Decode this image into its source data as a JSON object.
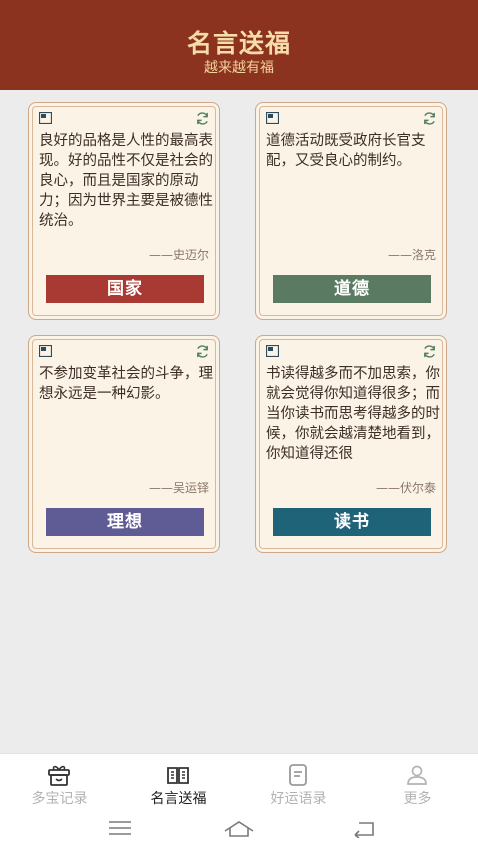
{
  "header": {
    "title": "名言送福",
    "subtitle": "越来越有福"
  },
  "cards": [
    {
      "quote": "良好的品格是人性的最高表现。好的品性不仅是社会的良心，而且是国家的原动力；因为世界主要是被德性统治。",
      "author": "——史迈尔",
      "tag": "国家",
      "tag_color": "#a83a33"
    },
    {
      "quote": "道德活动既受政府长官支配，又受良心的制约。",
      "author": "——洛克",
      "tag": "道德",
      "tag_color": "#5a7a61"
    },
    {
      "quote": "不参加变革社会的斗争，理想永远是一种幻影。",
      "author": "——吴运铎",
      "tag": "理想",
      "tag_color": "#5f5b94"
    },
    {
      "quote": "书读得越多而不加思索，你就会觉得你知道得很多；而当你读书而思考得越多的时候，你就会越清楚地看到，你知道得还很",
      "author": "——伏尔泰",
      "tag": "读书",
      "tag_color": "#1e6378"
    }
  ],
  "tabs": [
    {
      "label": "多宝记录",
      "icon": "gift-box-icon"
    },
    {
      "label": "名言送福",
      "icon": "open-book-icon"
    },
    {
      "label": "好运语录",
      "icon": "document-icon"
    },
    {
      "label": "更多",
      "icon": "person-icon"
    }
  ],
  "active_tab": "名言送福",
  "colors": {
    "header_bg": "#8c3320",
    "header_text": "#f5dca8",
    "card_bg": "#fbf3e6"
  }
}
